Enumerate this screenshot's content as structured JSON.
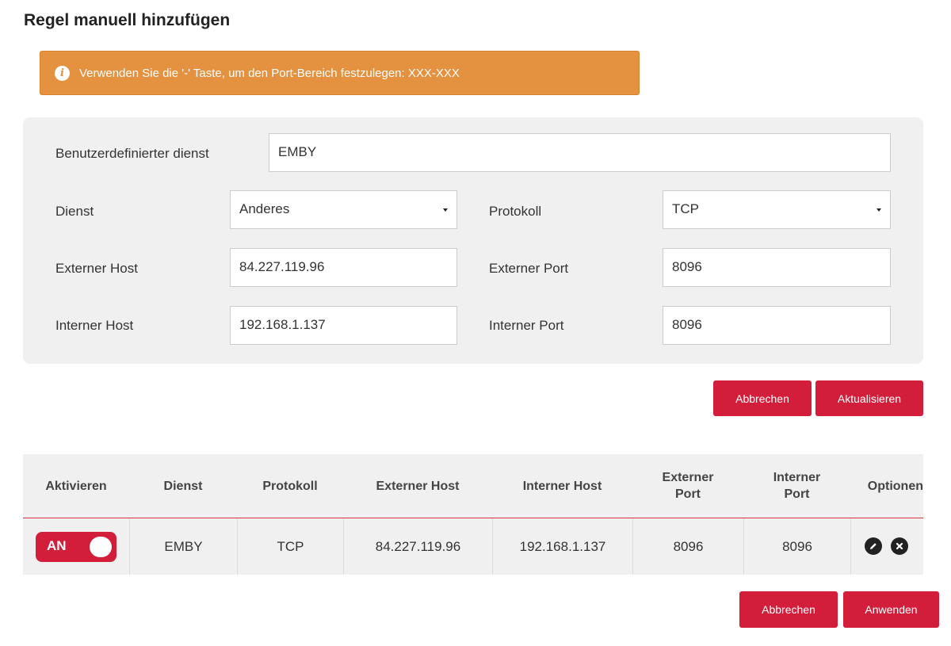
{
  "page": {
    "title": "Regel manuell hinzufügen"
  },
  "alert": {
    "icon": "info-icon",
    "text": "Verwenden Sie die '-' Taste, um den Port-Bereich festzulegen: XXX-XXX"
  },
  "form": {
    "custom_service": {
      "label": "Benutzerdefinierter dienst",
      "value": "EMBY"
    },
    "service": {
      "label": "Dienst",
      "value": "Anderes"
    },
    "protocol": {
      "label": "Protokoll",
      "value": "TCP"
    },
    "external_host": {
      "label": "Externer Host",
      "value": "84.227.119.96"
    },
    "external_port": {
      "label": "Externer Port",
      "value": "8096"
    },
    "internal_host": {
      "label": "Interner Host",
      "value": "192.168.1.137"
    },
    "internal_port": {
      "label": "Interner Port",
      "value": "8096"
    }
  },
  "form_buttons": {
    "cancel": "Abbrechen",
    "update": "Aktualisieren"
  },
  "table": {
    "headers": {
      "enable": "Aktivieren",
      "service": "Dienst",
      "protocol": "Protokoll",
      "external_host": "Externer Host",
      "internal_host": "Interner Host",
      "external_port_1": "Externer",
      "external_port_2": "Port",
      "internal_port_1": "Interner",
      "internal_port_2": "Port",
      "options": "Optionen"
    },
    "rows": [
      {
        "toggle_label": "AN",
        "service": "EMBY",
        "protocol": "TCP",
        "external_host": "84.227.119.96",
        "internal_host": "192.168.1.137",
        "external_port": "8096",
        "internal_port": "8096"
      }
    ]
  },
  "footer_buttons": {
    "cancel": "Abbrechen",
    "apply": "Anwenden"
  },
  "colors": {
    "accent": "#d21e3a",
    "alert": "#e49140",
    "panel": "#f0f0f0"
  }
}
